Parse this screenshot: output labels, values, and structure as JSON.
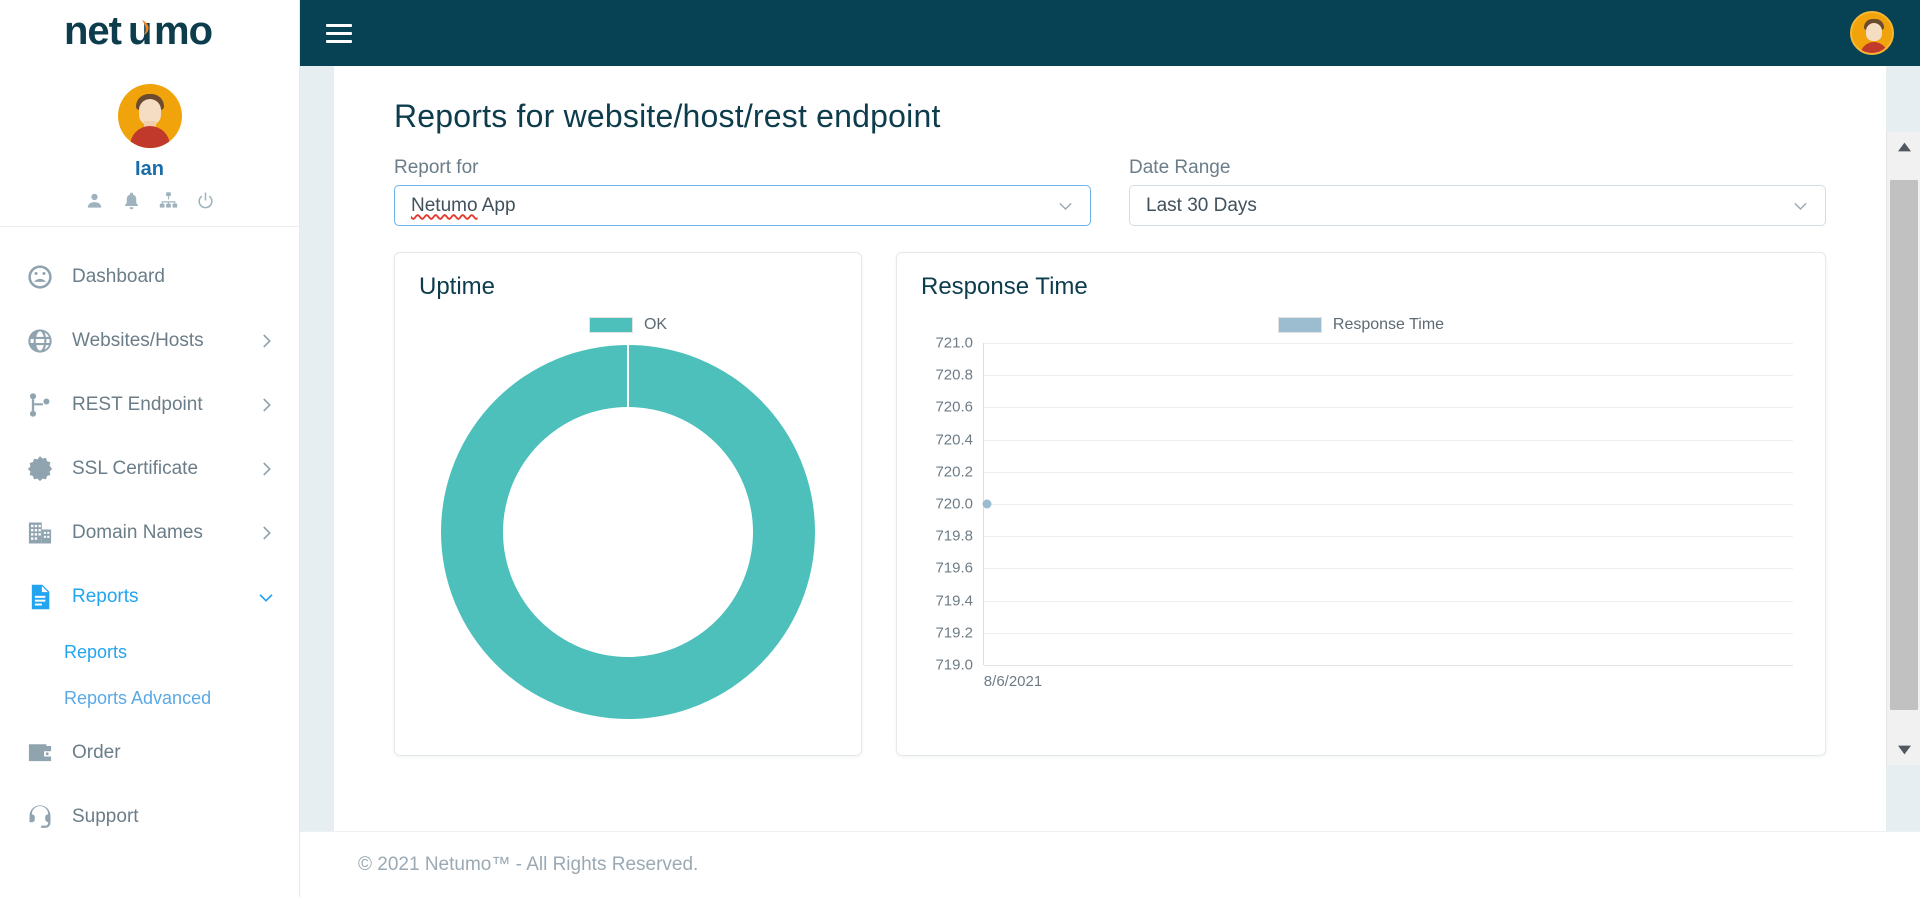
{
  "brand": {
    "logo_text": "netumo",
    "logo_dark": "#0d3d4d",
    "logo_accent": "#f58220"
  },
  "topbar": {
    "menu_icon": "hamburger-icon",
    "avatar": "user-avatar"
  },
  "sidebar": {
    "profile": {
      "name": "Ian",
      "avatar": "user-avatar"
    },
    "quick_icons": [
      {
        "name": "profile-icon"
      },
      {
        "name": "bell-icon"
      },
      {
        "name": "sitemap-icon"
      },
      {
        "name": "power-icon"
      }
    ],
    "items": [
      {
        "label": "Dashboard",
        "icon": "gauge-icon",
        "expandable": false,
        "active": false
      },
      {
        "label": "Websites/Hosts",
        "icon": "globe-icon",
        "expandable": true,
        "active": false
      },
      {
        "label": "REST Endpoint",
        "icon": "branch-icon",
        "expandable": true,
        "active": false
      },
      {
        "label": "SSL Certificate",
        "icon": "certificate-icon",
        "expandable": true,
        "active": false
      },
      {
        "label": "Domain Names",
        "icon": "building-icon",
        "expandable": true,
        "active": false
      },
      {
        "label": "Reports",
        "icon": "document-icon",
        "expandable": true,
        "active": true
      }
    ],
    "sub_items": [
      {
        "label": "Reports",
        "current": true
      },
      {
        "label": "Reports Advanced",
        "current": false
      }
    ],
    "items_bottom": [
      {
        "label": "Order",
        "icon": "wallet-icon",
        "expandable": false,
        "active": false
      },
      {
        "label": "Support",
        "icon": "headset-icon",
        "expandable": false,
        "active": false
      }
    ]
  },
  "page": {
    "title": "Reports for website/host/rest endpoint",
    "report_for": {
      "label": "Report for",
      "value_misspelled": "Netumo",
      "value_rest": " App",
      "value": "Netumo App",
      "chevron": "chevron-down-icon"
    },
    "date_range": {
      "label": "Date Range",
      "value": "Last 30 Days",
      "chevron": "chevron-down-icon"
    }
  },
  "cards": {
    "uptime_title": "Uptime",
    "response_title": "Response Time"
  },
  "colors": {
    "teal": "#4dc0bb",
    "response_blue": "#9cbcd0",
    "navbar": "#064254",
    "accent_blue": "#23a4f0",
    "heading": "#0d3d4d"
  },
  "footer": {
    "text": "© 2021 Netumo™ - All Rights Reserved."
  },
  "scrollbar": {
    "up_icon": "scroll-up-arrow",
    "down_icon": "scroll-down-arrow"
  },
  "chart_data": [
    {
      "type": "pie",
      "title": "Uptime",
      "variant": "donut",
      "legend": [
        "OK"
      ],
      "legend_position": "top",
      "labels": [
        "OK"
      ],
      "values": [
        100
      ],
      "colors": [
        "#4dc0bb"
      ],
      "units": "percent"
    },
    {
      "type": "scatter",
      "title": "Response Time",
      "legend": [
        "Response Time"
      ],
      "legend_position": "top",
      "series": [
        {
          "name": "Response Time",
          "color": "#9cbcd0",
          "x": [
            "8/6/2021"
          ],
          "values": [
            720.0
          ]
        }
      ],
      "x": [
        "8/6/2021"
      ],
      "xlabel": "",
      "ylabel": "",
      "ylim": [
        719.0,
        721.0
      ],
      "yticks": [
        721.0,
        720.8,
        720.6,
        720.4,
        720.2,
        720.0,
        719.8,
        719.6,
        719.4,
        719.2,
        719.0
      ],
      "ytick_labels": [
        "721.0",
        "720.8",
        "720.6",
        "720.4",
        "720.2",
        "720.0",
        "719.8",
        "719.6",
        "719.4",
        "719.2",
        "719.0"
      ],
      "xtick_labels": [
        "8/6/2021"
      ],
      "grid": true
    }
  ]
}
